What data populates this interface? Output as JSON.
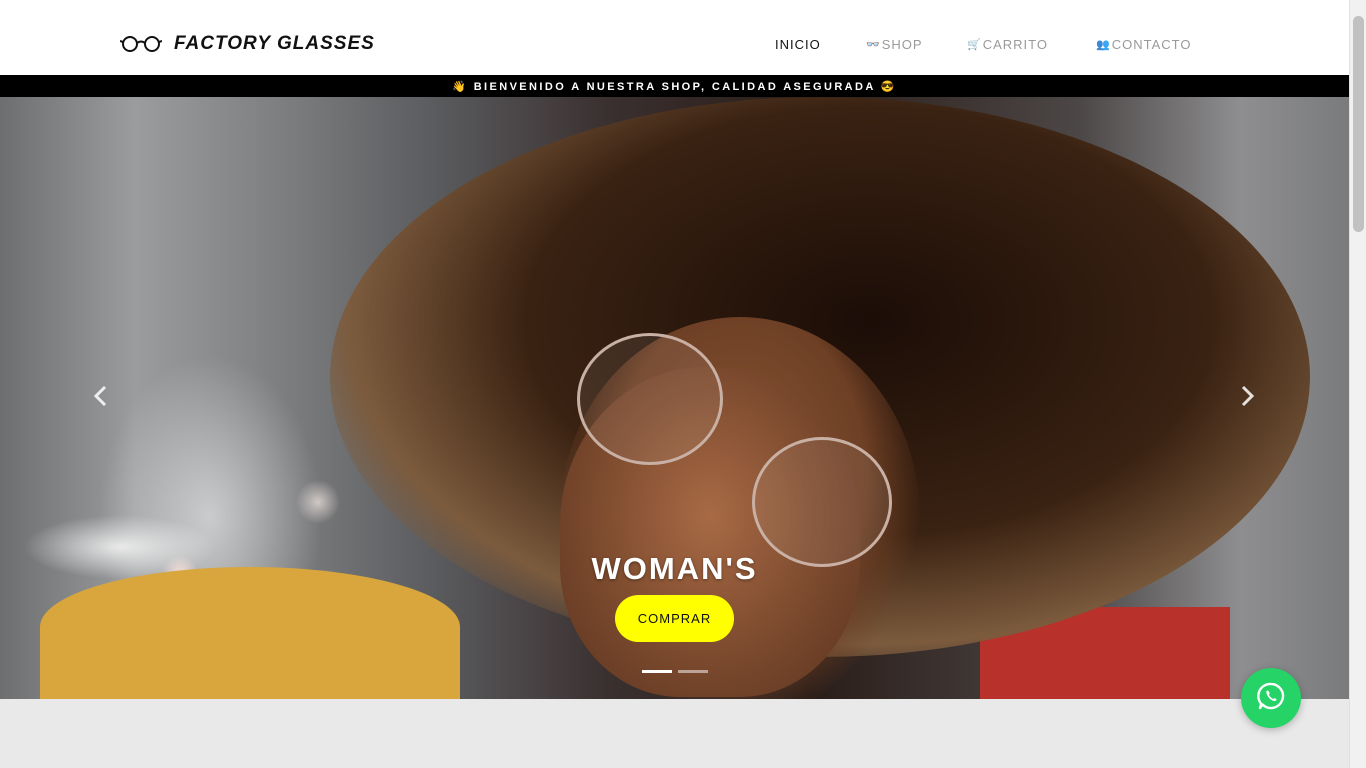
{
  "brand": {
    "name": "FACTORY GLASSES",
    "icon": "eyeglasses-icon"
  },
  "nav": {
    "items": [
      {
        "label": "INICIO",
        "icon": "",
        "active": true
      },
      {
        "label": "SHOP",
        "icon": "glasses-icon",
        "active": false
      },
      {
        "label": "CARRITO",
        "icon": "cart-icon",
        "active": false
      },
      {
        "label": "CONTACTO",
        "icon": "contact-icon",
        "active": false
      }
    ]
  },
  "banner": {
    "text": "👋 BIENVENIDO A NUESTRA SHOP, CALIDAD ASEGURADA 😎"
  },
  "carousel": {
    "caption_title": "WOMAN'S",
    "cta_label": "COMPRAR",
    "slide_count": 2,
    "active_slide": 0,
    "prev_icon": "chevron-left-icon",
    "next_icon": "chevron-right-icon"
  },
  "whatsapp": {
    "icon": "whatsapp-icon"
  },
  "colors": {
    "cta": "#ffff00",
    "banner_bg": "#000000",
    "whatsapp": "#25d366",
    "nav_active": "#111111",
    "nav_inactive": "#9a9a9a"
  }
}
